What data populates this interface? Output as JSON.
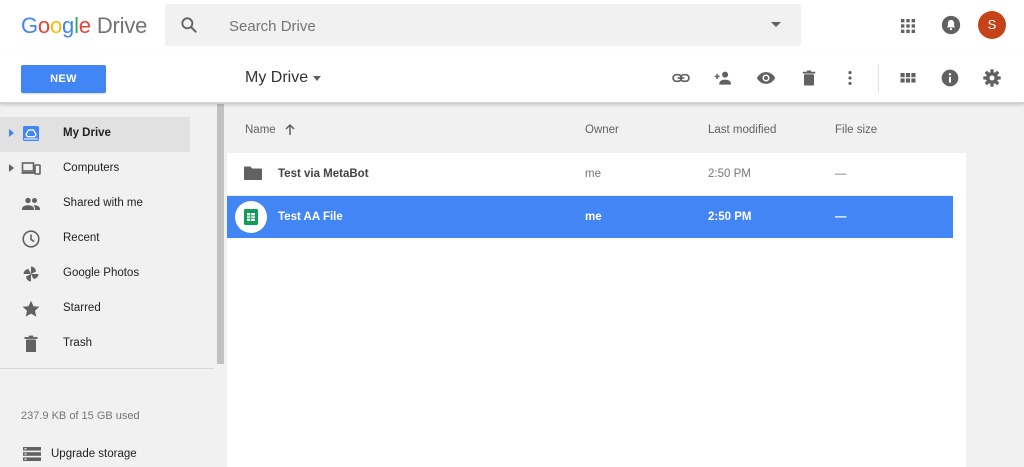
{
  "header": {
    "logo_word": [
      "G",
      "o",
      "o",
      "g",
      "l",
      "e"
    ],
    "logo_colors": [
      "#4285f4",
      "#ea4335",
      "#fbbc05",
      "#4285f4",
      "#34a853",
      "#ea4335"
    ],
    "logo_product": "Drive",
    "search_placeholder": "Search Drive",
    "avatar_initial": "S",
    "avatar_color": "#c64218"
  },
  "toolbar": {
    "new_label": "NEW",
    "location_title": "My Drive",
    "actions": [
      "link-icon",
      "add-person-icon",
      "preview-eye-icon",
      "trash-icon",
      "more-vert-icon",
      "grid-view-icon",
      "info-icon",
      "settings-gear-icon"
    ],
    "accent_color": "#4285f4"
  },
  "sidebar": {
    "items": [
      {
        "label": "My Drive",
        "icon": "my-drive-icon",
        "active": true,
        "expandable": true
      },
      {
        "label": "Computers",
        "icon": "computers-icon",
        "active": false,
        "expandable": true
      },
      {
        "label": "Shared with me",
        "icon": "people-icon",
        "active": false,
        "expandable": false
      },
      {
        "label": "Recent",
        "icon": "clock-icon",
        "active": false,
        "expandable": false
      },
      {
        "label": "Google Photos",
        "icon": "pinwheel-icon",
        "active": false,
        "expandable": false
      },
      {
        "label": "Starred",
        "icon": "star-icon",
        "active": false,
        "expandable": false
      },
      {
        "label": "Trash",
        "icon": "trash-icon",
        "active": false,
        "expandable": false
      }
    ],
    "storage_text": "237.9 KB of 15 GB used",
    "upgrade_label": "Upgrade storage"
  },
  "file_list": {
    "columns": {
      "name": "Name",
      "owner": "Owner",
      "last_modified": "Last modified",
      "file_size": "File size"
    },
    "rows": [
      {
        "name": "Test via MetaBot",
        "type": "folder",
        "owner": "me",
        "last_modified": "2:50 PM",
        "file_size": "—",
        "selected": false
      },
      {
        "name": "Test AA File",
        "type": "google-sheets",
        "owner": "me",
        "last_modified": "2:50 PM",
        "file_size": "—",
        "selected": true
      }
    ],
    "selection_color": "#4285f4"
  }
}
